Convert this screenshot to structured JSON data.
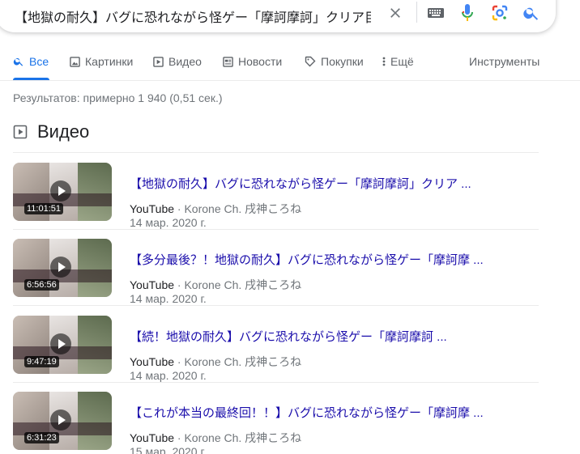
{
  "search": {
    "query": "【地獄の耐久】バグに恐れながら怪ゲー「摩訶摩訶」クリア目",
    "clear_icon": "close-icon",
    "keyboard_icon": "keyboard-icon",
    "mic_icon": "mic-icon",
    "lens_icon": "camera-lens-icon",
    "search_icon": "search-icon"
  },
  "tabs": [
    {
      "label": "Все",
      "icon": "search-icon",
      "active": true
    },
    {
      "label": "Картинки",
      "icon": "image-icon"
    },
    {
      "label": "Видео",
      "icon": "video-icon"
    },
    {
      "label": "Новости",
      "icon": "news-icon"
    },
    {
      "label": "Покупки",
      "icon": "tag-icon"
    },
    {
      "label": "Ещё",
      "icon": "more-vert-icon"
    }
  ],
  "tools_label": "Инструменты",
  "stats": "Результатов: примерно 1 940 (0,51 сек.)",
  "videos_heading": "Видео",
  "results": [
    {
      "title": "【地獄の耐久】バグに恐れながら怪ゲー「摩訶摩訶」クリア ...",
      "source": "YouTube",
      "channel": "Korone Ch. 戌神ころね",
      "date": "14 мар. 2020 г.",
      "duration": "11:01:51"
    },
    {
      "title": "【多分最後？！地獄の耐久】バグに恐れながら怪ゲー「摩訶摩 ...",
      "source": "YouTube",
      "channel": "Korone Ch. 戌神ころね",
      "date": "14 мар. 2020 г.",
      "duration": "6:56:56"
    },
    {
      "title": "【続！地獄の耐久】バグに恐れながら怪ゲー「摩訶摩訶 ...",
      "source": "YouTube",
      "channel": "Korone Ch. 戌神ころね",
      "date": "14 мар. 2020 г.",
      "duration": "9:47:19"
    },
    {
      "title": "【これが本当の最終回！！】バグに恐れながら怪ゲー「摩訶摩 ...",
      "source": "YouTube",
      "channel": "Korone Ch. 戌神ころね",
      "date": "15 мар. 2020 г.",
      "duration": "6:31:23"
    }
  ]
}
